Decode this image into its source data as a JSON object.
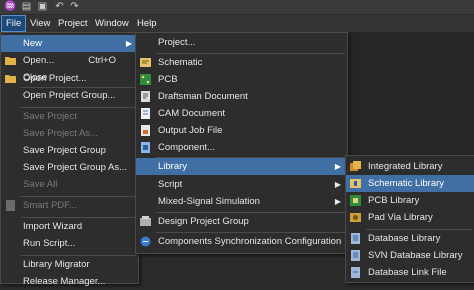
{
  "colors": {
    "menu_bg": "#2d2d2d",
    "highlight": "#3f6fa3",
    "menubar_active": "#1d4a7a",
    "disabled_text": "#7a7a7a"
  },
  "toolbar": {
    "icons": [
      "app-logo-icon",
      "folder-open-icon",
      "save-icon",
      "undo-icon",
      "redo-icon"
    ]
  },
  "menubar": {
    "file": "File",
    "view": "View",
    "project": "Project",
    "window": "Window",
    "help": "Help"
  },
  "file_menu": {
    "new": "New",
    "open": "Open...",
    "open_shortcut": "Ctrl+O",
    "close": "Close",
    "open_project": "Open Project...",
    "open_project_group": "Open Project Group...",
    "save_project": "Save Project",
    "save_project_as": "Save Project As...",
    "save_project_group": "Save Project Group",
    "save_project_group_as": "Save Project Group As...",
    "save_all": "Save All",
    "smart_pdf": "Smart PDF...",
    "import_wizard": "Import Wizard",
    "run_script": "Run Script...",
    "library_migrator": "Library Migrator",
    "cutoff": "Release Manager..."
  },
  "new_menu": {
    "project": "Project...",
    "schematic": "Schematic",
    "pcb": "PCB",
    "draftsman": "Draftsman Document",
    "cam": "CAM Document",
    "output_job": "Output Job File",
    "component": "Component...",
    "library": "Library",
    "script": "Script",
    "mixed_signal": "Mixed-Signal Simulation",
    "design_project_group": "Design Project Group",
    "components_sync": "Components Synchronization Configuration"
  },
  "library_menu": {
    "integrated": "Integrated Library",
    "schematic": "Schematic Library",
    "pcb": "PCB Library",
    "pad_via": "Pad Via Library",
    "database": "Database Library",
    "svn_database": "SVN Database Library",
    "database_link": "Database Link File"
  }
}
